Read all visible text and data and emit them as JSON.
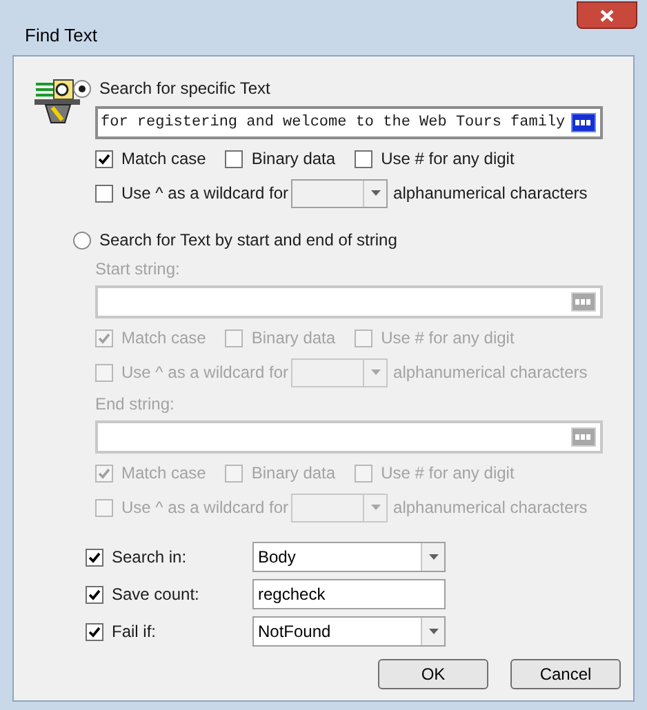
{
  "window": {
    "title": "Find Text"
  },
  "search_modes": [
    {
      "label": "Search for specific Text",
      "selected": true,
      "disabled": false,
      "strings": [
        {
          "value": "for registering and welcome to the Web Tours family",
          "options": [
            {
              "label": "Match case",
              "checked": true
            },
            {
              "label": "Binary data",
              "checked": false
            },
            {
              "label": "Use # for any digit",
              "checked": false
            }
          ],
          "wildcard": {
            "label": "Use ^ as a wildcard for",
            "checked": false,
            "suffix": "alphanumerical characters"
          }
        }
      ]
    },
    {
      "label": "Search for Text by start and end of string",
      "selected": false,
      "disabled": true,
      "strings": [
        {
          "label": "Start string:",
          "options": [
            {
              "label": "Match case",
              "checked": true
            },
            {
              "label": "Binary data",
              "checked": false
            },
            {
              "label": "Use # for any digit",
              "checked": false
            }
          ],
          "wildcard": {
            "label": "Use ^ as a wildcard for",
            "checked": false,
            "suffix": "alphanumerical characters"
          }
        },
        {
          "label": "End string:",
          "options": [
            {
              "label": "Match case",
              "checked": true
            },
            {
              "label": "Binary data",
              "checked": false
            },
            {
              "label": "Use # for any digit",
              "checked": false
            }
          ],
          "wildcard": {
            "label": "Use ^ as a wildcard for",
            "checked": false,
            "suffix": "alphanumerical characters"
          }
        }
      ]
    }
  ],
  "settings": [
    {
      "label": "Search in:",
      "checked": true,
      "kind": "dropdown",
      "value": "Body"
    },
    {
      "label": "Save count:",
      "checked": true,
      "kind": "text",
      "value": "regcheck"
    },
    {
      "label": "Fail if:",
      "checked": true,
      "kind": "dropdown",
      "value": "NotFound"
    }
  ],
  "buttons": [
    "OK",
    "Cancel"
  ]
}
